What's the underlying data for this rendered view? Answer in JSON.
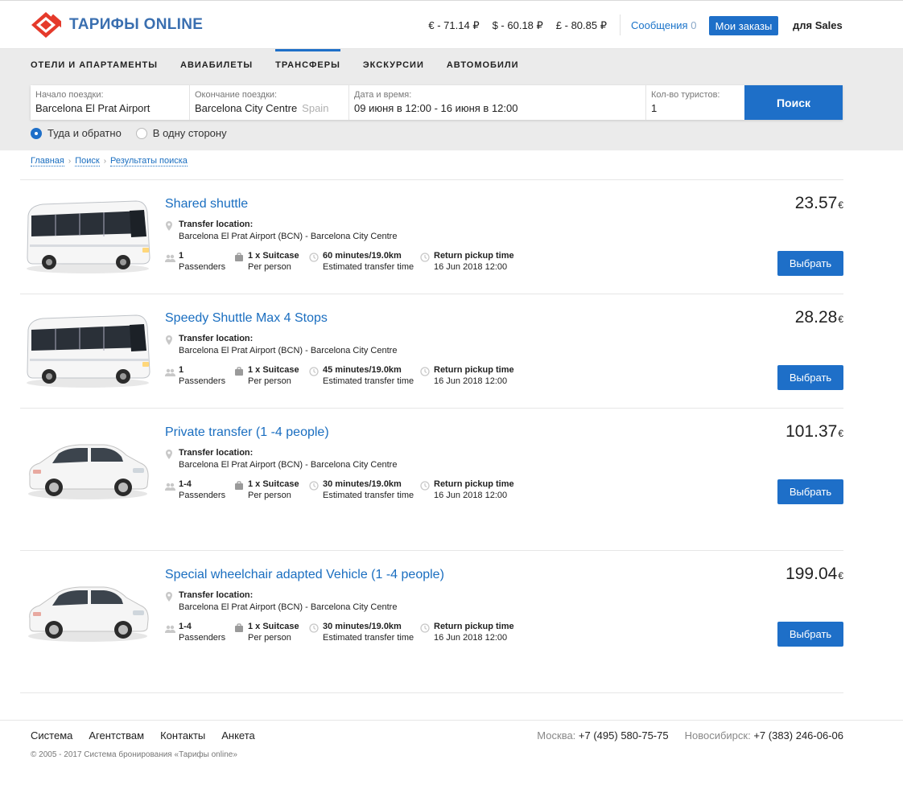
{
  "brand": {
    "name": "ТАРИФЫ ONLINE"
  },
  "header": {
    "rates": [
      "€ - 71.14 ₽",
      "$ - 60.18 ₽",
      "£ - 80.85 ₽"
    ],
    "messages_label": "Сообщения",
    "messages_count": "0",
    "orders_label": "Мои заказы",
    "user": "для Sales"
  },
  "tabs": [
    {
      "label": "ОТЕЛИ И АПАРТАМЕНТЫ"
    },
    {
      "label": "АВИАБИЛЕТЫ"
    },
    {
      "label": "ТРАНСФЕРЫ",
      "active": true
    },
    {
      "label": "ЭКСКУРСИИ"
    },
    {
      "label": "АВТОМОБИЛИ"
    }
  ],
  "search": {
    "start": {
      "label": "Начало поездки:",
      "value": "Barcelona El Prat Airport"
    },
    "end": {
      "label": "Окончание поездки:",
      "value": "Barcelona City Centre",
      "hint": "Spain"
    },
    "dates": {
      "label": "Дата и время:",
      "value": "09 июня в 12:00 - 16 июня в 12:00"
    },
    "tourists": {
      "label": "Кол-во туристов:",
      "value": "1"
    },
    "button": "Поиск",
    "round_trip": "Туда и обратно",
    "one_way": "В одну сторону"
  },
  "breadcrumb": [
    "Главная",
    "Поиск",
    "Результаты поиска"
  ],
  "labels": {
    "location": "Transfer location:",
    "passengers": "Passenders",
    "per_person": "Per person",
    "estimated": "Estimated transfer time",
    "return_pickup": "Return pickup time",
    "select": "Выбрать",
    "currency": "€"
  },
  "results": [
    {
      "title": "Shared shuttle",
      "price": "23.57",
      "vehicle": "bus",
      "location": "Barcelona El Prat Airport (BCN) - Barcelona City Centre",
      "passengers": "1",
      "luggage": "1 x Suitcase",
      "duration": "60 minutes/19.0km",
      "return_time": "16 Jun 2018 12:00"
    },
    {
      "title": "Speedy Shuttle Max 4 Stops",
      "price": "28.28",
      "vehicle": "bus",
      "location": "Barcelona El Prat Airport (BCN) - Barcelona City Centre",
      "passengers": "1",
      "luggage": "1 x Suitcase",
      "duration": "45 minutes/19.0km",
      "return_time": "16 Jun 2018 12:00"
    },
    {
      "title": "Private transfer (1 -4 people)",
      "price": "101.37",
      "vehicle": "car",
      "location": "Barcelona El Prat Airport (BCN) - Barcelona City Centre",
      "passengers": "1-4",
      "luggage": "1 x Suitcase",
      "duration": "30 minutes/19.0km",
      "return_time": "16 Jun 2018 12:00"
    },
    {
      "title": "Special wheelchair adapted Vehicle (1 -4 people)",
      "price": "199.04",
      "vehicle": "car",
      "location": "Barcelona El Prat Airport (BCN) - Barcelona City Centre",
      "passengers": "1-4",
      "luggage": "1 x Suitcase",
      "duration": "30 minutes/19.0km",
      "return_time": "16 Jun 2018 12:00"
    }
  ],
  "footer": {
    "links": [
      "Система",
      "Агентствам",
      "Контакты",
      "Анкета"
    ],
    "phones": [
      {
        "city": "Москва:",
        "phone": "+7 (495) 580-75-75"
      },
      {
        "city": "Новосибирск:",
        "phone": "+7 (383) 246-06-06"
      }
    ],
    "copyright": "© 2005 - 2017 Система бронирования «Тарифы online»"
  },
  "colors": {
    "accent": "#1e6fc8",
    "link": "#1a6ec0",
    "logo_red": "#e53a2b"
  }
}
